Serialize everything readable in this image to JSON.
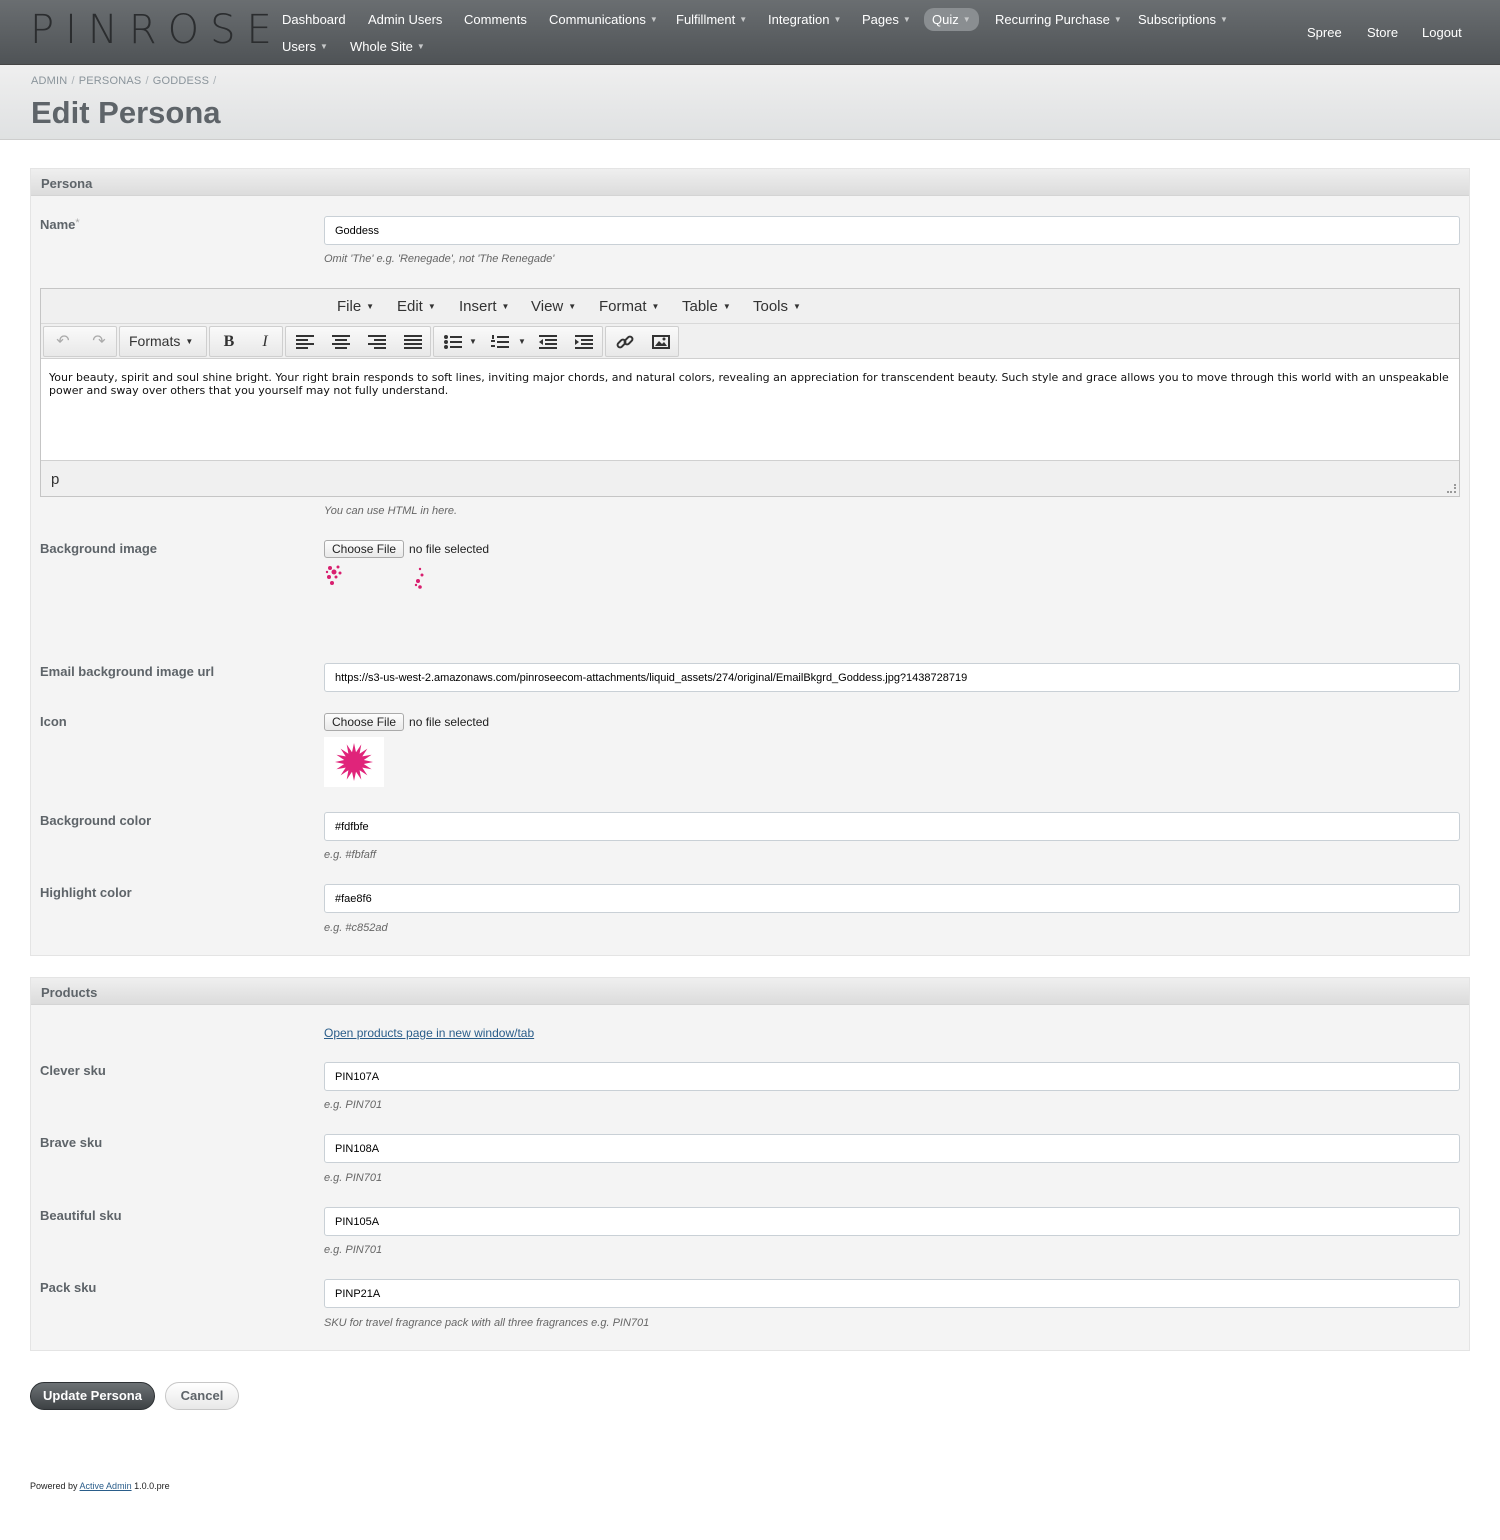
{
  "logo": "PINROSE",
  "nav": [
    {
      "label": "Dashboard",
      "caret": false
    },
    {
      "label": "Admin Users",
      "caret": false
    },
    {
      "label": "Comments",
      "caret": false
    },
    {
      "label": "Communications",
      "caret": true
    },
    {
      "label": "Fulfillment",
      "caret": true
    },
    {
      "label": "Integration",
      "caret": true
    },
    {
      "label": "Pages",
      "caret": true
    },
    {
      "label": "Quiz",
      "caret": true,
      "current": true
    },
    {
      "label": "Recurring Purchase",
      "caret": true
    },
    {
      "label": "Subscriptions",
      "caret": true
    },
    {
      "label": "Users",
      "caret": true
    },
    {
      "label": "Whole Site",
      "caret": true
    }
  ],
  "utility_nav": [
    "Spree",
    "Store",
    "Logout"
  ],
  "breadcrumb": [
    "ADMIN",
    "PERSONAS",
    "GODDESS"
  ],
  "breadcrumb_sep": "/",
  "page_title": "Edit Persona",
  "persona_panel": {
    "title": "Persona",
    "name_label": "Name",
    "required_mark": "*",
    "name_value": "Goddess",
    "name_hint": "Omit 'The' e.g. 'Renegade', not 'The Renegade'",
    "editor": {
      "menus": [
        "File",
        "Edit",
        "Insert",
        "View",
        "Format",
        "Table",
        "Tools"
      ],
      "formats_label": "Formats",
      "content": "Your beauty, spirit and soul shine bright. Your right brain responds to soft lines, inviting major chords, and natural colors, revealing an appreciation for transcendent beauty. Such style and grace allows you to move through this world with an unspeakable power and sway over others that you yourself may not fully understand.",
      "status_path": "p"
    },
    "editor_hint": "You can use HTML in here.",
    "background_image_label": "Background image",
    "choose_file": "Choose File",
    "no_file": "no file selected",
    "email_bg_label": "Email background image url",
    "email_bg_value": "https://s3-us-west-2.amazonaws.com/pinroseecom-attachments/liquid_assets/274/original/EmailBkgrd_Goddess.jpg?1438728719",
    "icon_label": "Icon",
    "background_color_label": "Background color",
    "background_color_value": "#fdfbfe",
    "background_color_hint": "e.g. #fbfaff",
    "highlight_color_label": "Highlight color",
    "highlight_color_value": "#fae8f6",
    "highlight_color_hint": "e.g. #c852ad",
    "icon_color": "#e0247a"
  },
  "products_panel": {
    "title": "Products",
    "products_link": "Open products page in new window/tab",
    "clever_label": "Clever sku",
    "clever_value": "PIN107A",
    "brave_label": "Brave sku",
    "brave_value": "PIN108A",
    "beautiful_label": "Beautiful sku",
    "beautiful_value": "PIN105A",
    "sku_hint": "e.g. PIN701",
    "pack_label": "Pack sku",
    "pack_value": "PINP21A",
    "pack_hint": "SKU for travel fragrance pack with all three fragrances e.g. PIN701"
  },
  "actions": {
    "submit": "Update Persona",
    "cancel": "Cancel"
  },
  "footer": {
    "prefix": "Powered by",
    "link": "Active Admin",
    "version": "1.0.0.pre"
  }
}
